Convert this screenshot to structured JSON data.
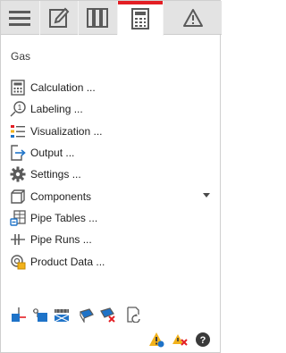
{
  "tabs": [
    {
      "icon": "hamburger-menu-icon",
      "active": false
    },
    {
      "icon": "pencil-edit-icon",
      "active": false
    },
    {
      "icon": "book-library-icon",
      "active": false
    },
    {
      "icon": "calculator-icon",
      "active": true
    },
    {
      "icon": "warning-icon",
      "active": false
    }
  ],
  "section": {
    "title": "Gas"
  },
  "menu": [
    {
      "label": "Calculation ...",
      "icon": "calculator-icon"
    },
    {
      "label": "Labeling ...",
      "icon": "label-tag-icon"
    },
    {
      "label": "Visualization ...",
      "icon": "visualization-list-icon"
    },
    {
      "label": "Output ...",
      "icon": "output-export-icon"
    },
    {
      "label": "Settings ...",
      "icon": "gear-icon"
    },
    {
      "label": "Components",
      "icon": "component-cube-icon",
      "has_dropdown": true
    },
    {
      "label": "Pipe Tables ...",
      "icon": "pipe-table-icon"
    },
    {
      "label": "Pipe Runs ...",
      "icon": "pipe-run-icon"
    },
    {
      "label": "Product Data ...",
      "icon": "product-data-icon"
    }
  ],
  "toolbar": [
    "connect-pipe-icon",
    "insert-node-icon",
    "valve-icon",
    "pipe-segment-icon",
    "delete-pipe-icon",
    "refresh-page-icon"
  ],
  "status": [
    "warning-info-icon",
    "warning-error-icon",
    "help-icon"
  ],
  "colors": {
    "accent": "#e31e24",
    "tab_bg": "#e3e3e3",
    "icon_blue": "#1e73c8",
    "icon_gray": "#5a5a5a",
    "warning_yellow": "#f2b21b"
  }
}
